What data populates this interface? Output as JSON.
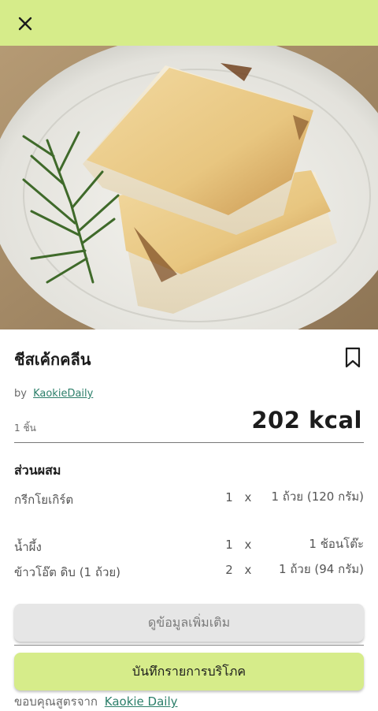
{
  "recipe": {
    "title": "ชีสเค้กคลีน",
    "by_label": "by",
    "author": "KaokieDaily",
    "portion": "1 ชิ้น",
    "kcal": "202 kcal"
  },
  "ingredients": {
    "title": "ส่วนผสม",
    "items": [
      {
        "name": "กรีกโยเกิร์ต",
        "qty": "1",
        "x": "x",
        "unit": "1 ถ้วย (120 กรัม)"
      },
      {
        "name": "น้ำผึ้ง",
        "qty": "1",
        "x": "x",
        "unit": "1 ช้อนโต๊ะ"
      },
      {
        "name": "ข้าวโอ๊ต ดิบ (1 ถ้วย)",
        "qty": "2",
        "x": "x",
        "unit": "1 ถ้วย (94 กรัม)"
      }
    ]
  },
  "actions": {
    "more_label": "ดูข้อมูลเพิ่มเติม",
    "save_label": "บันทึกรายการบริโภค"
  },
  "credit": {
    "prefix": "ขอบคุณสูตรจาก",
    "link": "Kaokie Daily"
  },
  "icons": {
    "close": "close-icon",
    "bookmark": "bookmark-icon"
  },
  "colors": {
    "accent": "#d6ec8a",
    "link": "#2c7f6a"
  }
}
